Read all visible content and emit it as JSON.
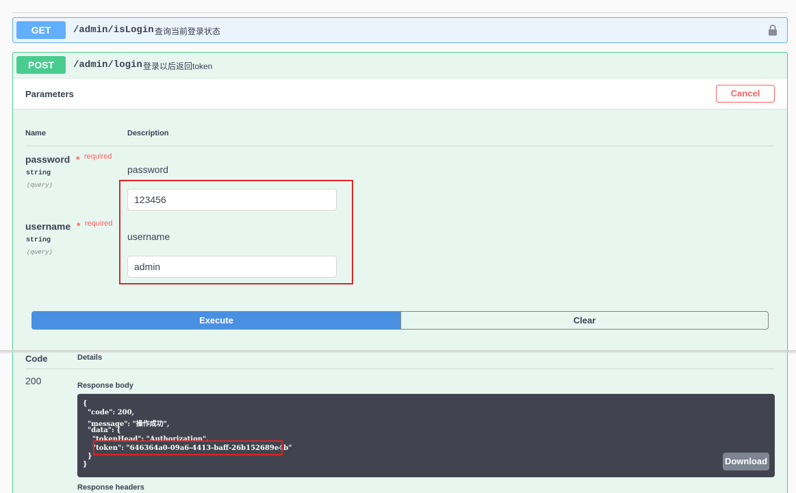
{
  "get_op": {
    "method": "GET",
    "path": "/admin/isLogin",
    "summary": "查询当前登录状态"
  },
  "post_op": {
    "method": "POST",
    "path": "/admin/login",
    "summary": "登录以后返回token",
    "parameters_title": "Parameters",
    "cancel_label": "Cancel",
    "col_name": "Name",
    "col_description": "Description",
    "params": [
      {
        "name": "password",
        "star": "*",
        "required": "required",
        "type": "string",
        "in": "(query)",
        "description": "password",
        "value": "123456"
      },
      {
        "name": "username",
        "star": "*",
        "required": "required",
        "type": "string",
        "in": "(query)",
        "description": "username",
        "value": "admin"
      }
    ],
    "execute_label": "Execute",
    "clear_label": "Clear"
  },
  "responses": {
    "code_header": "Code",
    "details_header": "Details",
    "code": "200",
    "body_header": "Response body",
    "body_lines": [
      "{",
      "  \"code\": 200,",
      "  \"message\": \"操作成功\",",
      "  \"data\": {",
      "    \"tokenHead\": \"Authorization\",",
      "    \"token\": \"646364a0-09a6-4413-baff-26b152689e4b\"",
      "  }",
      "}"
    ],
    "download_label": "Download",
    "headers_header": "Response headers"
  },
  "colors": {
    "get": "#61affe",
    "post": "#49cc90",
    "execute": "#4990e2",
    "cancel": "#ff6060",
    "highlight": "#e02424"
  },
  "icons": {
    "lock": "lock-icon"
  }
}
